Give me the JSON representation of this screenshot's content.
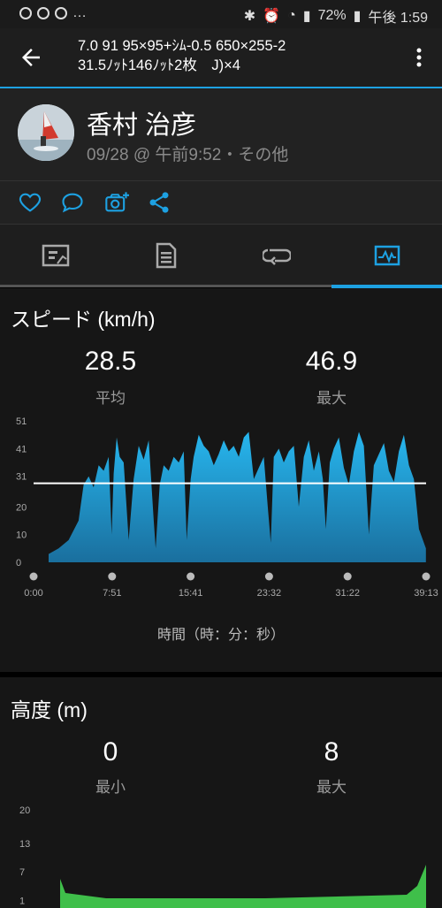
{
  "status_bar": {
    "battery": "72%",
    "time": "午後 1:59"
  },
  "app_bar": {
    "title": "7.0 91 95×95+ｼﾑ-0.5 650×255-2\n31.5ﾉｯﾄ146ﾉｯﾄ2枚　J)×4"
  },
  "profile": {
    "name": "香村 治彦",
    "meta": "09/28 @ 午前9:52・その他"
  },
  "actions": [
    "heart-icon",
    "comment-icon",
    "camera-add-icon",
    "share-icon"
  ],
  "tabs": [
    "summary-tab",
    "details-tab",
    "laps-tab",
    "chart-tab"
  ],
  "speed": {
    "title": "スピード (km/h)",
    "avg_value": "28.5",
    "avg_label": "平均",
    "max_value": "46.9",
    "max_label": "最大",
    "xlabel": "時間（時：分：秒）"
  },
  "elevation": {
    "title": "高度 (m)",
    "min_value": "0",
    "min_label": "最小",
    "max_value": "8",
    "max_label": "最大"
  },
  "colors": {
    "accent": "#1da1e2",
    "speed_fill": "#1e8fc4",
    "elev_fill": "#3fbf4a"
  },
  "chart_data": [
    {
      "type": "area",
      "title": "スピード (km/h)",
      "xlabel": "時間（時：分：秒）",
      "x_ticks": [
        "0:00",
        "7:51",
        "15:41",
        "23:32",
        "31:22",
        "39:13"
      ],
      "y_ticks": [
        0,
        10,
        20,
        31,
        41,
        51
      ],
      "ylim": [
        0,
        51
      ],
      "average_line": 28.5,
      "x": [
        0.0,
        1.5,
        2.5,
        3.5,
        4.5,
        5.0,
        5.5,
        6.0,
        6.5,
        7.0,
        7.5,
        7.8,
        8.0,
        8.3,
        8.6,
        9.0,
        9.5,
        10.0,
        10.5,
        11.0,
        11.5,
        12.0,
        12.2,
        12.6,
        13.0,
        13.5,
        14.0,
        14.5,
        15.0,
        15.3,
        15.7,
        16.0,
        16.5,
        17.0,
        17.5,
        18.0,
        18.5,
        19.0,
        19.5,
        20.0,
        20.5,
        21.0,
        21.5,
        22.0,
        22.5,
        23.0,
        23.4,
        23.7,
        24.0,
        24.5,
        25.0,
        25.5,
        26.0,
        26.5,
        27.0,
        27.5,
        28.0,
        28.5,
        28.9,
        29.2,
        29.6,
        30.0,
        30.5,
        31.0,
        31.5,
        32.0,
        32.5,
        33.0,
        33.5,
        34.0,
        34.5,
        35.0,
        35.5,
        36.0,
        36.5,
        37.0,
        37.5,
        38.0,
        38.5,
        39.2
      ],
      "values": [
        null,
        3,
        5,
        8,
        15,
        28,
        31,
        27,
        35,
        33,
        38,
        10,
        32,
        45,
        38,
        36,
        8,
        30,
        42,
        37,
        44,
        15,
        5,
        28,
        35,
        33,
        38,
        36,
        40,
        8,
        30,
        38,
        46,
        42,
        40,
        35,
        39,
        44,
        40,
        42,
        38,
        45,
        47,
        30,
        34,
        38,
        20,
        7,
        38,
        41,
        36,
        40,
        42,
        20,
        38,
        44,
        33,
        40,
        30,
        12,
        36,
        41,
        45,
        34,
        28,
        40,
        47,
        42,
        10,
        35,
        39,
        43,
        33,
        29,
        40,
        46,
        35,
        30,
        12,
        5
      ]
    },
    {
      "type": "area",
      "title": "高度 (m)",
      "y_ticks": [
        1,
        7,
        13,
        20
      ],
      "ylim": [
        0,
        20
      ],
      "min": 0,
      "max": 8
    }
  ]
}
